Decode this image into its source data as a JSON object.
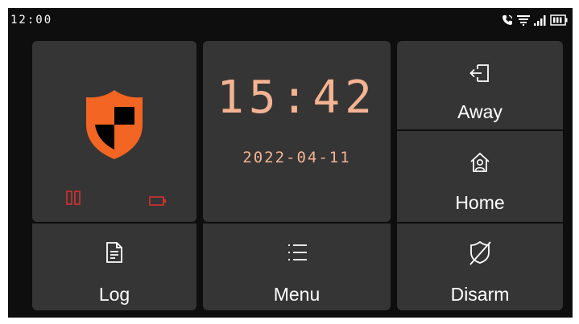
{
  "status_bar": {
    "time": "12:00",
    "icons": [
      "phone-call-icon",
      "wifi-icon",
      "cellular-signal-icon",
      "battery-icon"
    ]
  },
  "security_panel": {
    "shield_icon": "shield-icon",
    "sensor_icons": [
      "door-sensor-icon",
      "battery-icon"
    ],
    "accent_color": "#f26522",
    "alert_color": "#e03030"
  },
  "clock": {
    "time": "15:42",
    "date": "2022-04-11",
    "color": "#f4b392"
  },
  "buttons": {
    "away": {
      "label": "Away",
      "icon": "exit-door-icon"
    },
    "home": {
      "label": "Home",
      "icon": "home-person-icon"
    },
    "log": {
      "label": "Log",
      "icon": "document-icon"
    },
    "menu": {
      "label": "Menu",
      "icon": "list-menu-icon"
    },
    "disarm": {
      "label": "Disarm",
      "icon": "disarm-slash-icon"
    }
  }
}
